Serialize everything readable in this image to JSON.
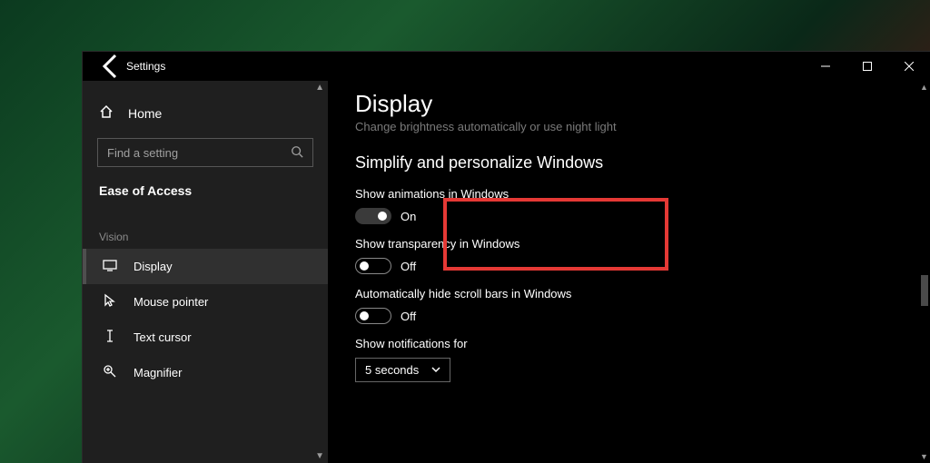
{
  "window": {
    "title": "Settings"
  },
  "sidebar": {
    "home_label": "Home",
    "search_placeholder": "Find a setting",
    "heading": "Ease of Access",
    "group": "Vision",
    "items": [
      {
        "label": "Display"
      },
      {
        "label": "Mouse pointer"
      },
      {
        "label": "Text cursor"
      },
      {
        "label": "Magnifier"
      }
    ]
  },
  "main": {
    "title": "Display",
    "subtitle": "Change brightness automatically or use night light",
    "section": "Simplify and personalize Windows",
    "settings": {
      "animations": {
        "label": "Show animations in Windows",
        "state": "On"
      },
      "transparency": {
        "label": "Show transparency in Windows",
        "state": "Off"
      },
      "scrollbars": {
        "label": "Automatically hide scroll bars in Windows",
        "state": "Off"
      },
      "notifications": {
        "label": "Show notifications for",
        "value": "5 seconds"
      }
    }
  }
}
